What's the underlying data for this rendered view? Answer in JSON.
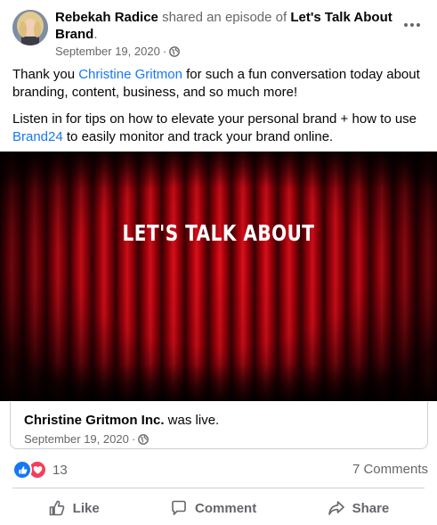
{
  "post": {
    "author": "Rebekah Radice",
    "action_text": "shared an episode of",
    "page_name": "Let's Talk About Brand",
    "period": ".",
    "date": "September 19, 2020",
    "date_sep": "·",
    "privacy_icon": "globe-icon",
    "more_icon": "more-options-icon",
    "message_p1_a": "Thank you ",
    "message_p1_link": "Christine Gritmon",
    "message_p1_b": " for such a fun conversation today about branding, content, business, and so much more!",
    "message_p2_a": "Listen in for tips on how to elevate your personal brand + how to use ",
    "message_p2_link": "Brand24",
    "message_p2_b": " to easily monitor and track your brand online."
  },
  "media": {
    "title": "LET'S TALK ABOUT",
    "background": "red-stage-curtain"
  },
  "attachment": {
    "name": "Christine Gritmon Inc.",
    "status": " was live.",
    "date": "September 19, 2020",
    "date_sep": "·"
  },
  "reactions": {
    "count": "13",
    "types": [
      "like",
      "love"
    ],
    "comments": "7 Comments"
  },
  "actions": {
    "like": "Like",
    "comment": "Comment",
    "share": "Share"
  },
  "colors": {
    "link": "#1877f2",
    "secondary_text": "#65676b",
    "like_blue": "#1877f2",
    "love_red": "#f33e58",
    "curtain_red": "#c4000b"
  }
}
